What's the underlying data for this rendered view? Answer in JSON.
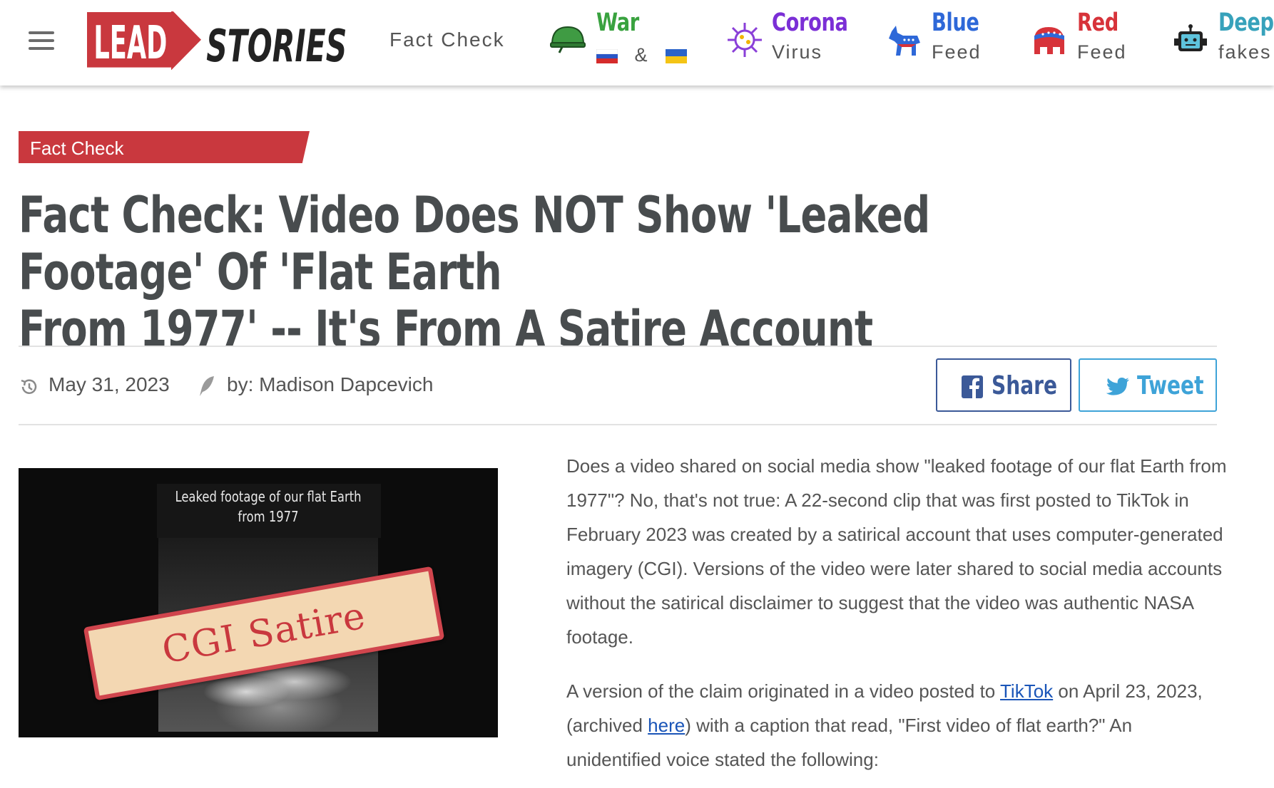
{
  "header": {
    "logo_text_left": "LEAD",
    "logo_text_right": "STORIES",
    "fact_check_link": "Fact Check",
    "nav": [
      {
        "title": "War",
        "sub_amp": "&",
        "icon": "helmet-icon",
        "color": "#39a23f"
      },
      {
        "title": "Corona",
        "sub": "Virus",
        "icon": "virus-icon",
        "color": "#7b2fd6"
      },
      {
        "title": "Blue",
        "sub": "Feed",
        "icon": "donkey-icon",
        "color": "#2e68d8"
      },
      {
        "title": "Red",
        "sub": "Feed",
        "icon": "elephant-icon",
        "color": "#d7333a"
      },
      {
        "title": "Deep",
        "sub": "fakes",
        "icon": "robot-icon",
        "color": "#37a2bb"
      }
    ]
  },
  "article": {
    "category_tag": "Fact Check",
    "headline_line1": "Fact Check: Video Does NOT Show 'Leaked Footage' Of 'Flat Earth",
    "headline_line2": "From 1977' -- It's From A Satire Account",
    "date": "May 31, 2023",
    "author": "by: Madison Dapcevich",
    "share_label": "Share",
    "tweet_label": "Tweet",
    "thumbnail": {
      "caption_line1": "Leaked footage of our flat Earth",
      "caption_line2": "from 1977",
      "stamp": "CGI Satire"
    },
    "paragraph1": "Does a video shared on social media show \"leaked footage of our flat Earth from 1977\"? No, that's not true: A 22-second clip that was first posted to TikTok in February 2023 was created by a satirical account that uses computer-generated imagery (CGI). Versions of the video were later shared to social media accounts without the satirical disclaimer to suggest that the video was authentic NASA footage.",
    "paragraph2_a": "A version of the claim originated in a video posted to ",
    "paragraph2_link1": "TikTok",
    "paragraph2_b": " on April 23, 2023, (archived ",
    "paragraph2_link2": "here",
    "paragraph2_c": ") with a caption that read, \"First video of flat earth?\" An unidentified voice stated the following:"
  },
  "colors": {
    "accent_red": "#c9383e",
    "facebook_blue": "#3b5998",
    "twitter_blue": "#3ea3d8",
    "link_blue": "#1a55b8"
  }
}
